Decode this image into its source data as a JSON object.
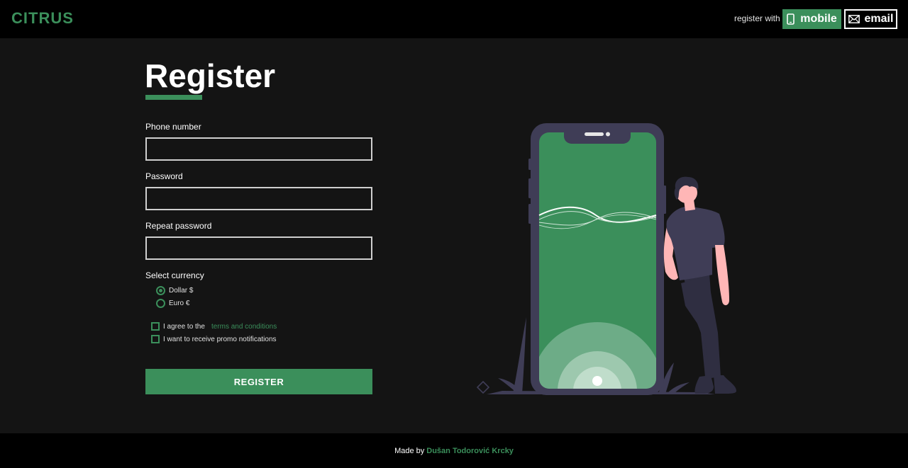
{
  "header": {
    "logo": "CITRUS",
    "register_with_label": "register with",
    "mobile_label": "mobile",
    "email_label": "email"
  },
  "form": {
    "title": "Register",
    "phone_label": "Phone number",
    "phone_value": "",
    "password_label": "Password",
    "password_value": "",
    "repeat_password_label": "Repeat password",
    "repeat_password_value": "",
    "currency_label": "Select currency",
    "currency_options": [
      {
        "label": "Dollar $",
        "selected": true
      },
      {
        "label": "Euro €",
        "selected": false
      }
    ],
    "agree_prefix": "I agree to the",
    "terms_link": "terms and conditions",
    "promo_label": "I want to receive promo notifications",
    "submit_label": "REGISTER"
  },
  "footer": {
    "made_by": "Made by",
    "author": "Dušan Todorović Krcky"
  },
  "colors": {
    "accent": "#3b8f5b",
    "background": "#141414",
    "bar": "#000000",
    "phone_frame": "#3f3d56",
    "skin": "#ffb6b6"
  },
  "icons": {
    "mobile": "mobile-phone-icon",
    "email": "envelope-icon"
  }
}
